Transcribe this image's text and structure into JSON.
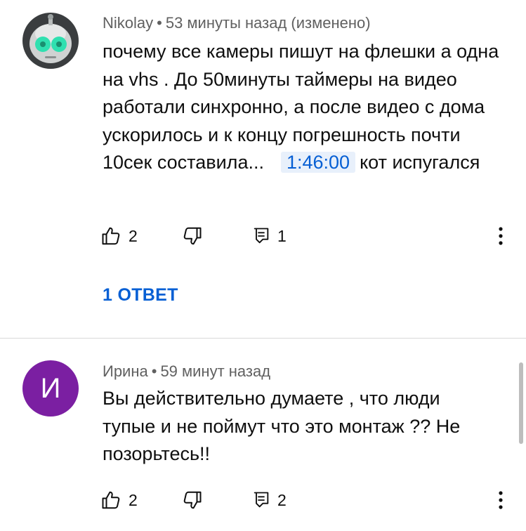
{
  "comments": [
    {
      "author": "Nikolay",
      "separator": "•",
      "time": "53 минуты назад (изменено)",
      "avatar_icon": "alien-robot-avatar",
      "text_before": "почему все камеры пишут на флешки а одна на vhs . До 50минуты таймеры на видео работали синхронно, а после видео с дома ускорилось и к концу погрешность почти 10сек составила...",
      "timestamp_link": "1:46:00",
      "text_after": "кот испугался",
      "likes": "2",
      "replies_count": "1",
      "replies_link": "1 ОТВЕТ"
    },
    {
      "author": "Ирина",
      "separator": "•",
      "time": "59 минут назад",
      "avatar_letter": "И",
      "avatar_color": "#7b1fa2",
      "text": "Вы действительно думаете , что люди тупые и не поймут что это монтаж ?? Не позорьтесь!!",
      "likes": "2",
      "replies_count": "2"
    }
  ],
  "colors": {
    "link_blue": "#065fd4",
    "timestamp_bg": "#e8f0fb",
    "meta_gray": "#606060"
  }
}
